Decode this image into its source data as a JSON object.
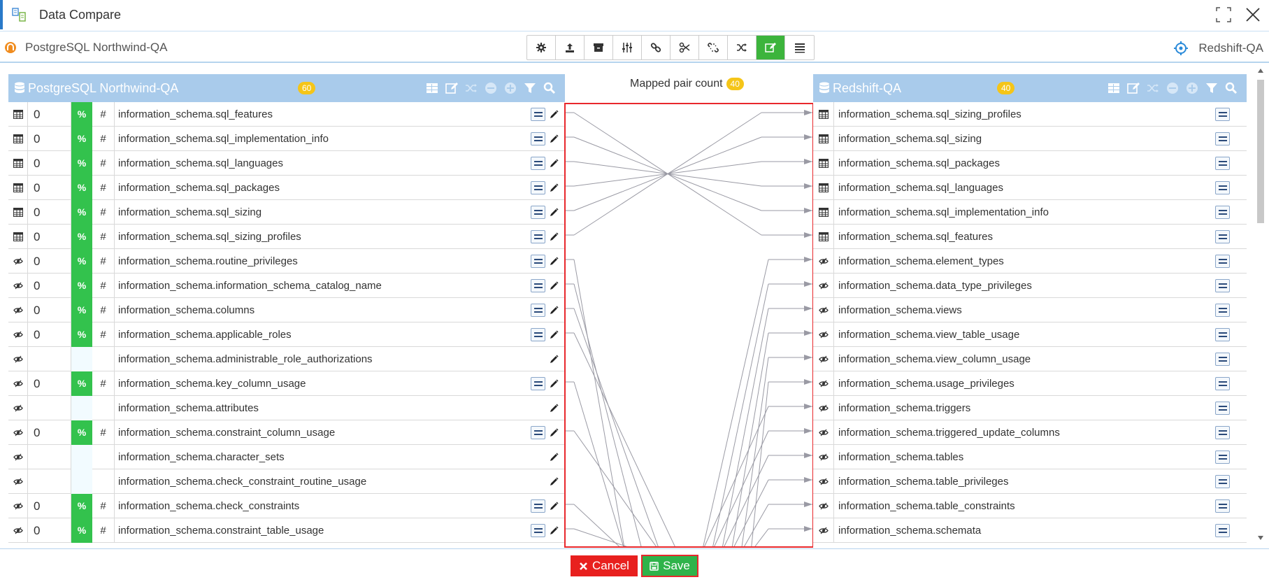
{
  "window": {
    "title": "Data Compare"
  },
  "connections": {
    "source": "PostgreSQL Northwind-QA",
    "target": "Redshift-QA"
  },
  "toolbar": {
    "buttons": [
      "settings-icon",
      "upload-icon",
      "archive-icon",
      "sliders-icon",
      "link-icon",
      "scissors-icon",
      "unlink-icon",
      "shuffle-icon",
      "edit-icon",
      "list-icon"
    ],
    "active": "edit-icon"
  },
  "left_panel": {
    "title": "PostgreSQL Northwind-QA",
    "count": "60",
    "rows": [
      {
        "type": "table",
        "zero": "0",
        "pct": "%",
        "hash": "#",
        "name": "information_schema.sql_features",
        "mapped": true
      },
      {
        "type": "table",
        "zero": "0",
        "pct": "%",
        "hash": "#",
        "name": "information_schema.sql_implementation_info",
        "mapped": true
      },
      {
        "type": "table",
        "zero": "0",
        "pct": "%",
        "hash": "#",
        "name": "information_schema.sql_languages",
        "mapped": true
      },
      {
        "type": "table",
        "zero": "0",
        "pct": "%",
        "hash": "#",
        "name": "information_schema.sql_packages",
        "mapped": true
      },
      {
        "type": "table",
        "zero": "0",
        "pct": "%",
        "hash": "#",
        "name": "information_schema.sql_sizing",
        "mapped": true
      },
      {
        "type": "table",
        "zero": "0",
        "pct": "%",
        "hash": "#",
        "name": "information_schema.sql_sizing_profiles",
        "mapped": true
      },
      {
        "type": "view",
        "zero": "0",
        "pct": "%",
        "hash": "#",
        "name": "information_schema.routine_privileges",
        "mapped": true
      },
      {
        "type": "view",
        "zero": "0",
        "pct": "%",
        "hash": "#",
        "name": "information_schema.information_schema_catalog_name",
        "mapped": true
      },
      {
        "type": "view",
        "zero": "0",
        "pct": "%",
        "hash": "#",
        "name": "information_schema.columns",
        "mapped": true
      },
      {
        "type": "view",
        "zero": "0",
        "pct": "%",
        "hash": "#",
        "name": "information_schema.applicable_roles",
        "mapped": true
      },
      {
        "type": "view",
        "zero": "",
        "pct": "",
        "hash": "",
        "name": "information_schema.administrable_role_authorizations",
        "mapped": false
      },
      {
        "type": "view",
        "zero": "0",
        "pct": "%",
        "hash": "#",
        "name": "information_schema.key_column_usage",
        "mapped": true
      },
      {
        "type": "view",
        "zero": "",
        "pct": "",
        "hash": "",
        "name": "information_schema.attributes",
        "mapped": false
      },
      {
        "type": "view",
        "zero": "0",
        "pct": "%",
        "hash": "#",
        "name": "information_schema.constraint_column_usage",
        "mapped": true
      },
      {
        "type": "view",
        "zero": "",
        "pct": "",
        "hash": "",
        "name": "information_schema.character_sets",
        "mapped": false
      },
      {
        "type": "view",
        "zero": "",
        "pct": "",
        "hash": "",
        "name": "information_schema.check_constraint_routine_usage",
        "mapped": false
      },
      {
        "type": "view",
        "zero": "0",
        "pct": "%",
        "hash": "#",
        "name": "information_schema.check_constraints",
        "mapped": true
      },
      {
        "type": "view",
        "zero": "0",
        "pct": "%",
        "hash": "#",
        "name": "information_schema.constraint_table_usage",
        "mapped": true
      }
    ]
  },
  "mapping": {
    "label": "Mapped pair count",
    "count": "40"
  },
  "right_panel": {
    "title": "Redshift-QA",
    "count": "40",
    "rows": [
      {
        "type": "table",
        "name": "information_schema.sql_sizing_profiles"
      },
      {
        "type": "table",
        "name": "information_schema.sql_sizing"
      },
      {
        "type": "table",
        "name": "information_schema.sql_packages"
      },
      {
        "type": "table",
        "name": "information_schema.sql_languages"
      },
      {
        "type": "table",
        "name": "information_schema.sql_implementation_info"
      },
      {
        "type": "table",
        "name": "information_schema.sql_features"
      },
      {
        "type": "view",
        "name": "information_schema.element_types"
      },
      {
        "type": "view",
        "name": "information_schema.data_type_privileges"
      },
      {
        "type": "view",
        "name": "information_schema.views"
      },
      {
        "type": "view",
        "name": "information_schema.view_table_usage"
      },
      {
        "type": "view",
        "name": "information_schema.view_column_usage"
      },
      {
        "type": "view",
        "name": "information_schema.usage_privileges"
      },
      {
        "type": "view",
        "name": "information_schema.triggers"
      },
      {
        "type": "view",
        "name": "information_schema.triggered_update_columns"
      },
      {
        "type": "view",
        "name": "information_schema.tables"
      },
      {
        "type": "view",
        "name": "information_schema.table_privileges"
      },
      {
        "type": "view",
        "name": "information_schema.table_constraints"
      },
      {
        "type": "view",
        "name": "information_schema.schemata"
      }
    ]
  },
  "footer": {
    "cancel_label": "Cancel",
    "save_label": "Save"
  },
  "colors": {
    "accent": "#2a7ac9",
    "panel_header": "#a9cbeb",
    "percent_green": "#33c24d",
    "badge": "#f5c518",
    "cancel": "#e8201e",
    "save": "#2fb34a",
    "highlight_border": "#e8282c"
  }
}
